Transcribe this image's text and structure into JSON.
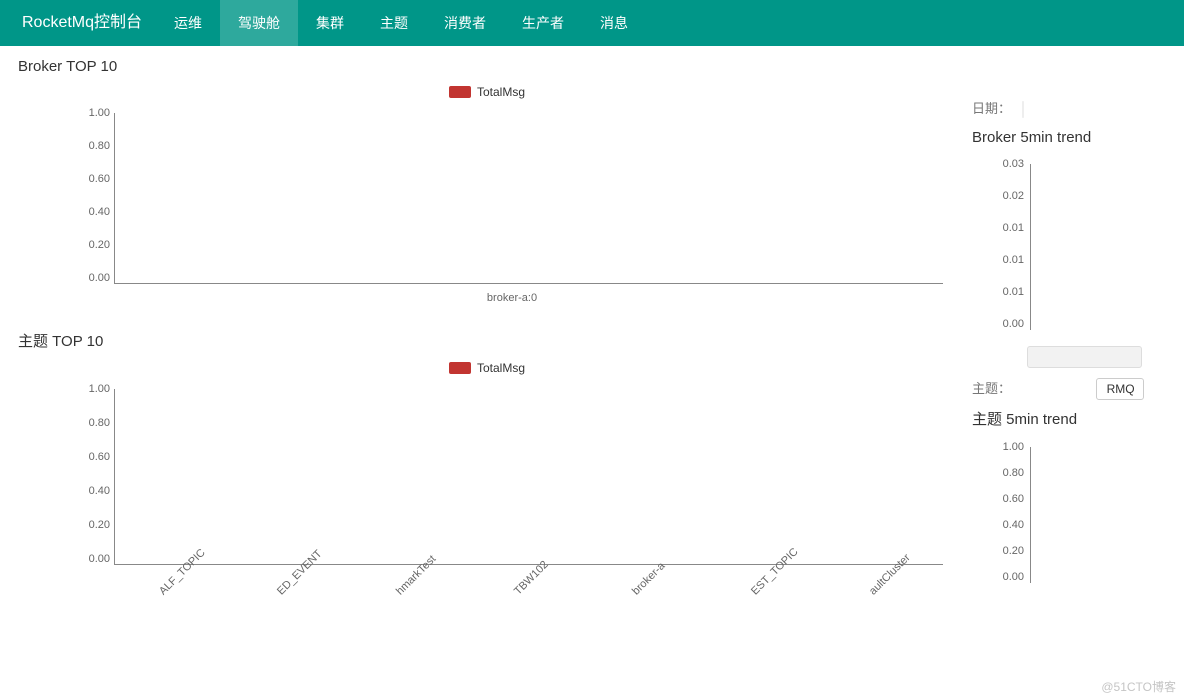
{
  "brand": "RocketMq控制台",
  "nav": [
    "运维",
    "驾驶舱",
    "集群",
    "主题",
    "消费者",
    "生产者",
    "消息"
  ],
  "nav_active_index": 1,
  "date_label": "日期：",
  "topic_label": "主题：",
  "topic_dropdown": "RMQ",
  "watermark": "@51CTO博客",
  "chart_data": [
    {
      "id": "broker-top10",
      "title": "Broker TOP 10",
      "legend": "TotalMsg",
      "type": "bar",
      "categories": [
        "broker-a:0"
      ],
      "series": [
        {
          "name": "TotalMsg",
          "values": [
            0
          ]
        }
      ],
      "yticks": [
        "1.00",
        "0.80",
        "0.60",
        "0.40",
        "0.20",
        "0.00"
      ],
      "ylim": [
        0,
        1
      ]
    },
    {
      "id": "topic-top10",
      "title": "主题 TOP 10",
      "legend": "TotalMsg",
      "type": "bar",
      "categories": [
        "ALF_TOPIC",
        "ED_EVENT",
        "hmarkTest",
        "TBW102",
        "broker-a",
        "EST_TOPIC",
        "aultCluster"
      ],
      "series": [
        {
          "name": "TotalMsg",
          "values": [
            0,
            0,
            0,
            0,
            0,
            0,
            0
          ]
        }
      ],
      "yticks": [
        "1.00",
        "0.80",
        "0.60",
        "0.40",
        "0.20",
        "0.00"
      ],
      "ylim": [
        0,
        1
      ]
    },
    {
      "id": "broker-5min",
      "title": "Broker 5min trend",
      "type": "line",
      "categories": [],
      "series": [],
      "yticks": [
        "0.03",
        "0.02",
        "0.01",
        "0.01",
        "0.01",
        "0.00"
      ],
      "ylim": [
        0,
        0.03
      ]
    },
    {
      "id": "topic-5min",
      "title": "主题 5min trend",
      "type": "line",
      "categories": [],
      "series": [],
      "yticks": [
        "1.00",
        "0.80",
        "0.60",
        "0.40",
        "0.20",
        "0.00"
      ],
      "ylim": [
        0,
        1
      ]
    }
  ]
}
